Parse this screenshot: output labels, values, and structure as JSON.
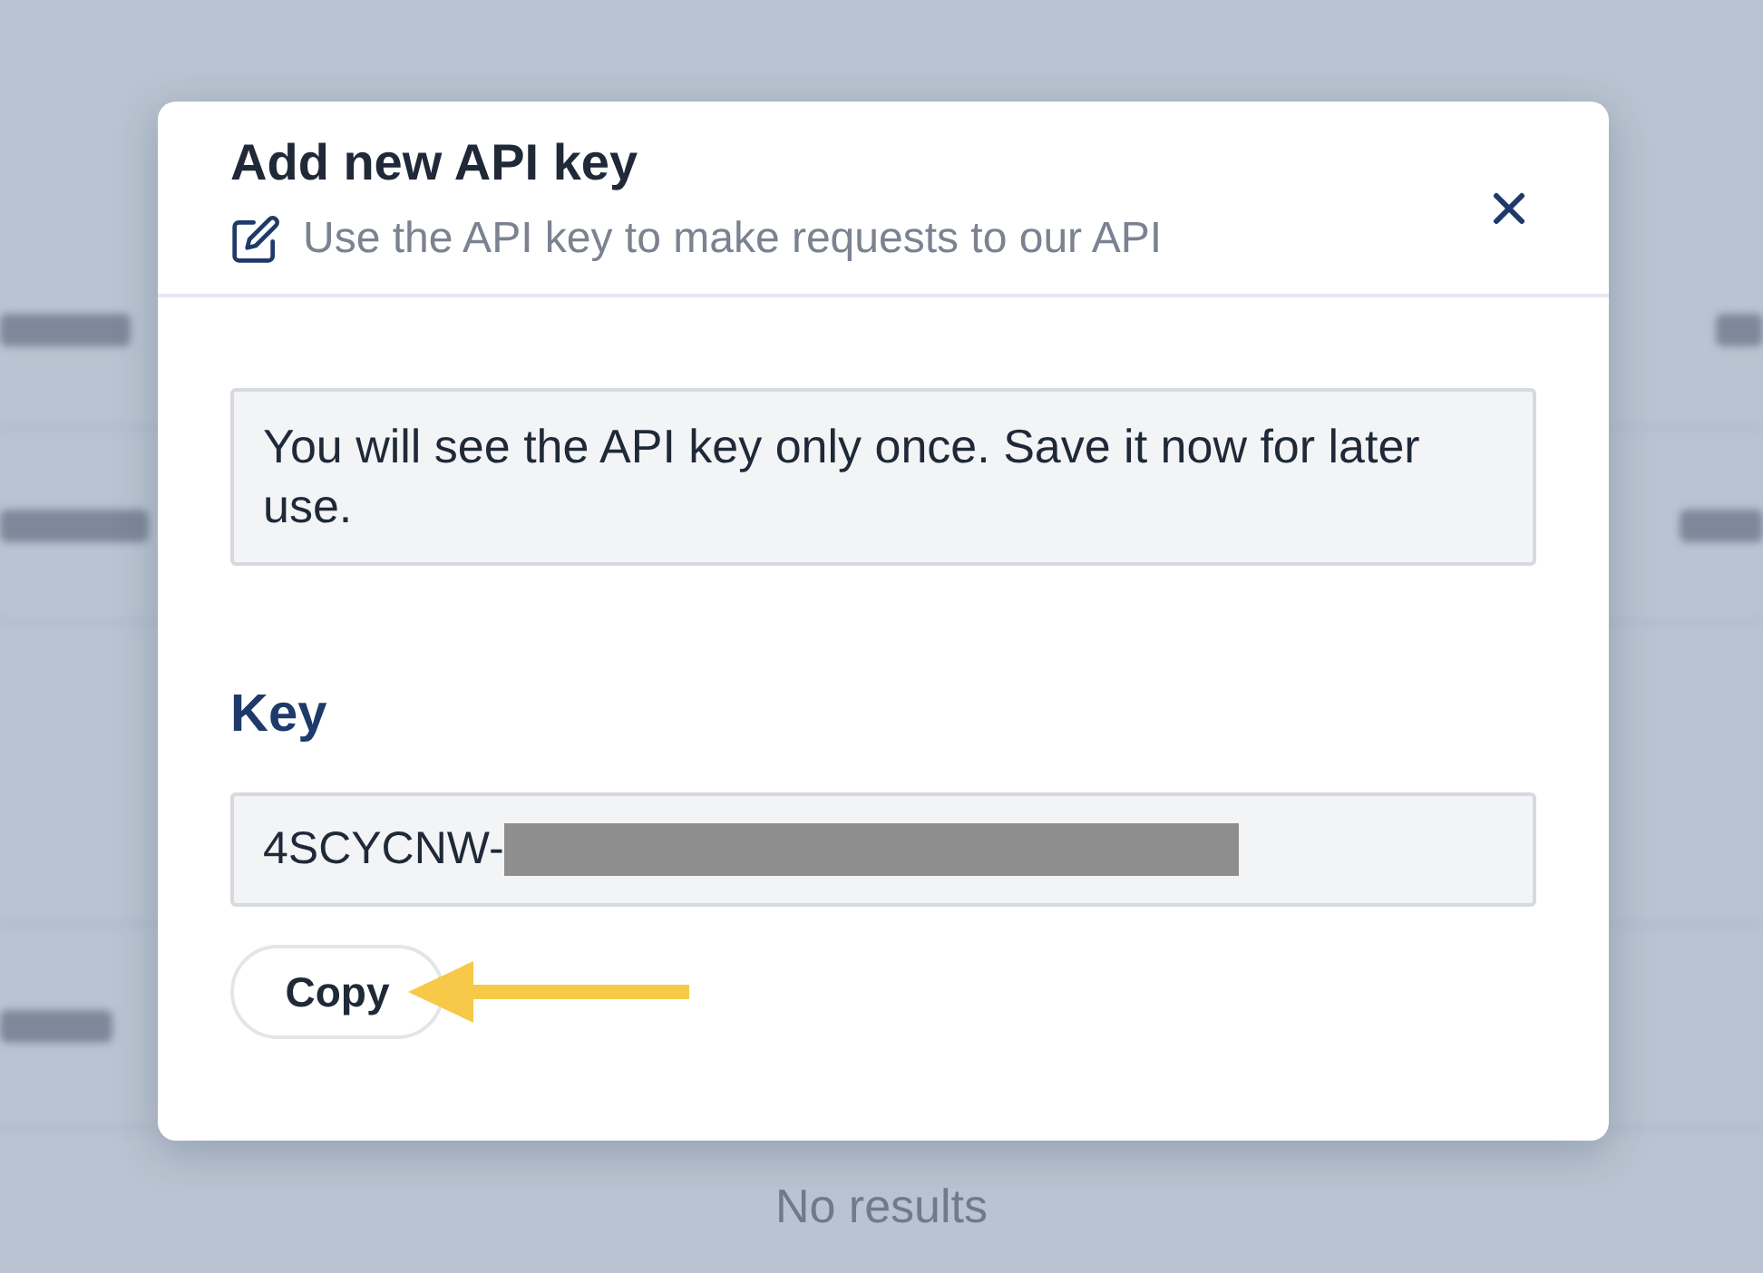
{
  "background": {
    "empty_message": "No results"
  },
  "dialog": {
    "title": "Add new API key",
    "subtitle": "Use the API key to make requests to our API",
    "notice": "You will see the API key only once. Save it now for later use.",
    "key_label": "Key",
    "key_value": "4SCYCNW-",
    "key_redacted": true,
    "copy_button": "Copy"
  }
}
